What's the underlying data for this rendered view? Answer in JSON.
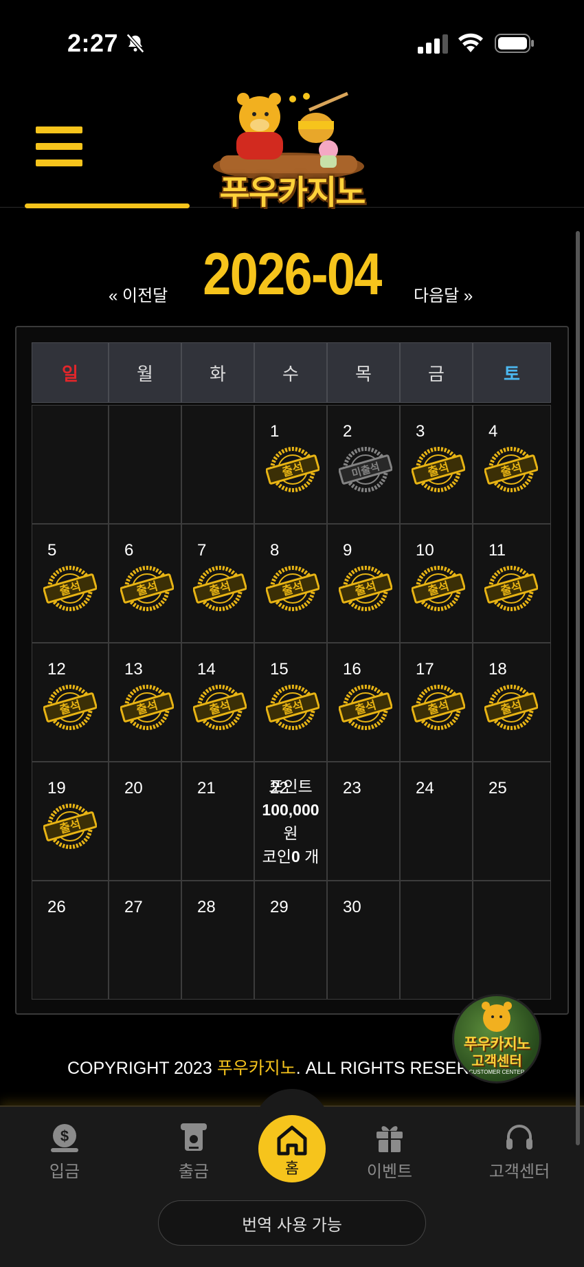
{
  "status_bar": {
    "time": "2:27"
  },
  "header": {
    "logo_text": "푸우카지노"
  },
  "calendar": {
    "prev_label": "« 이전달",
    "next_label": "다음달 »",
    "month_title": "2026-04",
    "weekdays": [
      "일",
      "월",
      "화",
      "수",
      "목",
      "금",
      "토"
    ],
    "days": [
      {
        "num": "",
        "stamp": ""
      },
      {
        "num": "",
        "stamp": ""
      },
      {
        "num": "",
        "stamp": ""
      },
      {
        "num": "1",
        "stamp": "출석"
      },
      {
        "num": "2",
        "stamp": "미출석"
      },
      {
        "num": "3",
        "stamp": "출석"
      },
      {
        "num": "4",
        "stamp": "출석"
      },
      {
        "num": "5",
        "stamp": "출석"
      },
      {
        "num": "6",
        "stamp": "출석"
      },
      {
        "num": "7",
        "stamp": "출석"
      },
      {
        "num": "8",
        "stamp": "출석"
      },
      {
        "num": "9",
        "stamp": "출석"
      },
      {
        "num": "10",
        "stamp": "출석"
      },
      {
        "num": "11",
        "stamp": "출석"
      },
      {
        "num": "12",
        "stamp": "출석"
      },
      {
        "num": "13",
        "stamp": "출석"
      },
      {
        "num": "14",
        "stamp": "출석"
      },
      {
        "num": "15",
        "stamp": "출석"
      },
      {
        "num": "16",
        "stamp": "출석"
      },
      {
        "num": "17",
        "stamp": "출석"
      },
      {
        "num": "18",
        "stamp": "출석"
      },
      {
        "num": "19",
        "stamp": "출석"
      },
      {
        "num": "20",
        "stamp": ""
      },
      {
        "num": "21",
        "stamp": ""
      },
      {
        "num": "22",
        "stamp": "",
        "today": true
      },
      {
        "num": "23",
        "stamp": ""
      },
      {
        "num": "24",
        "stamp": ""
      },
      {
        "num": "25",
        "stamp": ""
      },
      {
        "num": "26",
        "stamp": ""
      },
      {
        "num": "27",
        "stamp": ""
      },
      {
        "num": "28",
        "stamp": ""
      },
      {
        "num": "29",
        "stamp": ""
      },
      {
        "num": "30",
        "stamp": ""
      },
      {
        "num": "",
        "stamp": ""
      },
      {
        "num": "",
        "stamp": ""
      }
    ],
    "today_info": {
      "point_label": "포인트",
      "point_value": "100,000",
      "point_unit": "원",
      "coin_label": "코인",
      "coin_value": "0",
      "coin_unit": " 개"
    }
  },
  "footer": {
    "copyright_prefix": "COPYRIGHT 2023 ",
    "copyright_brand": "푸우카지노",
    "copyright_suffix": ". ALL RIGHTS RESERVED."
  },
  "cs_badge": {
    "line1": "푸우카지노",
    "line2": "고객센터",
    "line3": "CUSTOMER CENTER"
  },
  "bottom_nav": {
    "deposit": "입금",
    "withdraw": "출금",
    "home": "홈",
    "event": "이벤트",
    "support": "고객센터",
    "translate": "번역 사용 가능"
  },
  "colors": {
    "accent": "#f6c41c",
    "sunday": "#e2262a",
    "saturday": "#4cb8f0",
    "background": "#000000"
  },
  "icons": [
    "bell-slash-icon",
    "signal-icon",
    "wifi-icon",
    "battery-icon",
    "menu-icon",
    "dollar-icon",
    "atm-icon",
    "home-icon",
    "gift-icon",
    "headset-icon"
  ]
}
